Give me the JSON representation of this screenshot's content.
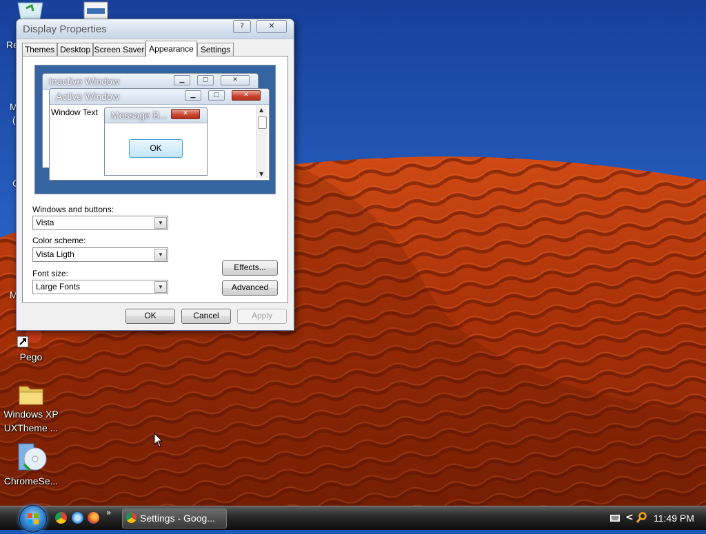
{
  "desktop": {
    "partial_labels": [
      "Re",
      "M",
      "(",
      "C",
      "M"
    ],
    "icons": [
      {
        "label": "Pego",
        "icon": "shortcut-icon"
      },
      {
        "label_line1": "Windows XP",
        "label_line2": "UXTheme ...",
        "icon": "folder-icon"
      },
      {
        "label": "ChromeSe...",
        "icon": "installer-disc-icon"
      }
    ]
  },
  "dialog": {
    "title": "Display Properties",
    "help_label": "?",
    "close_label": "✕",
    "tabs": [
      "Themes",
      "Desktop",
      "Screen Saver",
      "Appearance",
      "Settings"
    ],
    "active_tab": "Appearance",
    "preview": {
      "inactive_title": "Inactive Window",
      "active_title": "Active Window",
      "window_text": "Window Text",
      "message_title": "Message B...",
      "ok_label": "OK"
    },
    "fields": {
      "windows_buttons_label": "Windows and buttons:",
      "windows_buttons_value": "Vista",
      "color_scheme_label": "Color scheme:",
      "color_scheme_value": "Vista Ligth",
      "font_size_label": "Font size:",
      "font_size_value": "Large Fonts"
    },
    "buttons": {
      "effects": "Effects...",
      "advanced": "Advanced",
      "ok": "OK",
      "cancel": "Cancel",
      "apply": "Apply"
    }
  },
  "taskbar": {
    "overflow_label": "»",
    "task_button_label": "Settings - Goog...",
    "tray_chevron": "<",
    "clock": "11:49 PM"
  },
  "colors": {
    "sky_top": "#1a4aa8",
    "sky_bottom": "#4f8ee0",
    "dune": "#b8360c",
    "dune_shadow": "#6e1c05",
    "accent_close": "#c7412b"
  }
}
